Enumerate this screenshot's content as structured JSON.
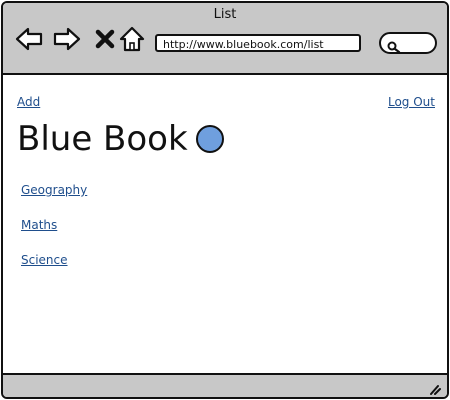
{
  "window": {
    "title": "List"
  },
  "toolbar": {
    "icons": [
      "back-arrow-icon",
      "forward-arrow-icon",
      "close-x-icon",
      "home-icon"
    ],
    "url": "http://www.bluebook.com/list",
    "search_icon": "search-icon"
  },
  "page": {
    "add_label": "Add",
    "logout_label": "Log Out",
    "heading": "Blue Book",
    "accent_color": "#6f9fde",
    "subjects": [
      "Geography",
      "Maths",
      "Science"
    ]
  }
}
